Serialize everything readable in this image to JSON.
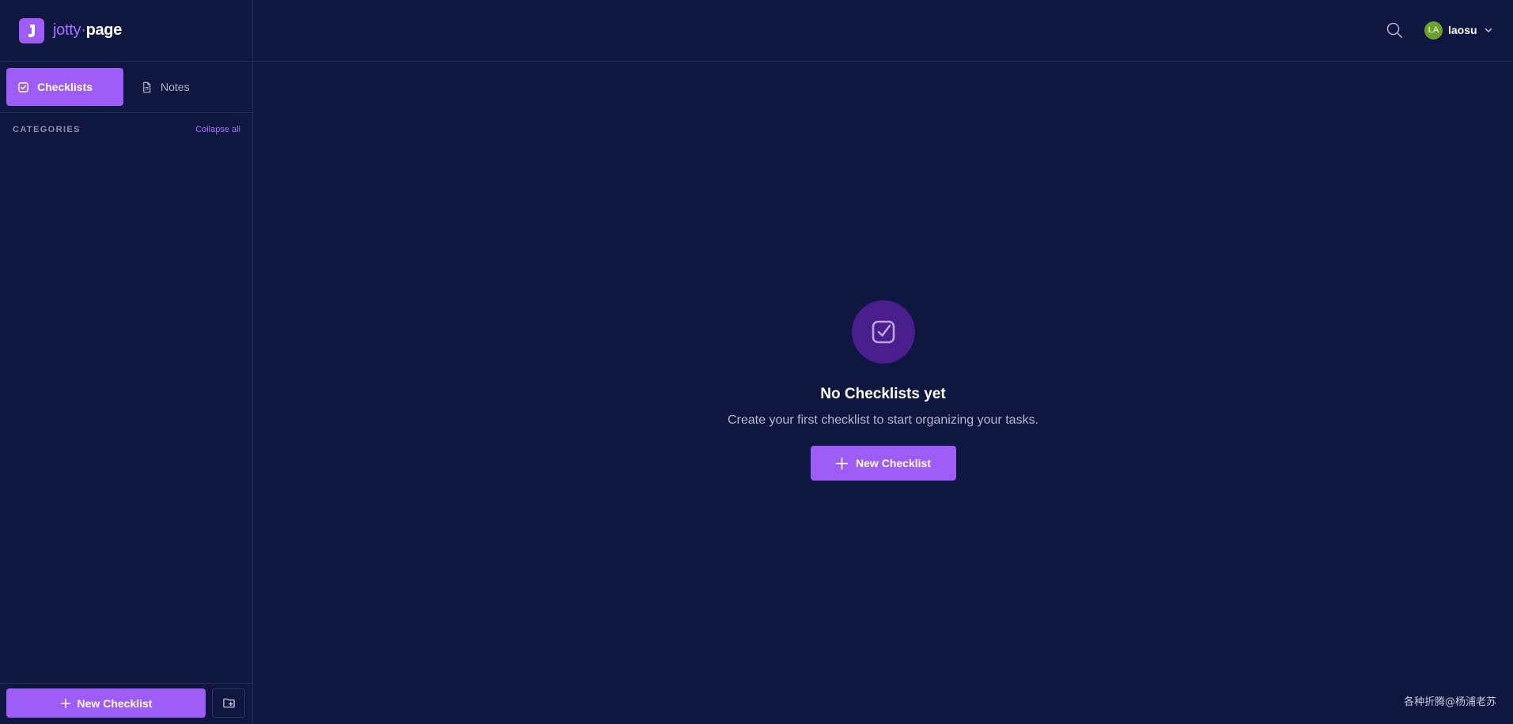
{
  "brand": {
    "name_part1": "jotty",
    "separator": "·",
    "name_part2": "page",
    "accent": "#9c5cf5"
  },
  "tabs": [
    {
      "label": "Checklists",
      "icon": "checkbox-icon",
      "active": true
    },
    {
      "label": "Notes",
      "icon": "document-icon",
      "active": false
    }
  ],
  "sidebar": {
    "categories_title": "CATEGORIES",
    "collapse_label": "Collapse all",
    "new_button_label": "New Checklist",
    "folder_icon": "folder-plus-icon"
  },
  "header": {
    "search_icon": "search-icon",
    "user": {
      "initials": "LA",
      "name": "laosu",
      "avatar_color": "#6aa22b"
    }
  },
  "empty_state": {
    "title": "No Checklists yet",
    "subtitle": "Create your first checklist to start organizing your tasks.",
    "button_label": "New Checklist"
  },
  "watermark": "各种折腾@杨浦老苏"
}
